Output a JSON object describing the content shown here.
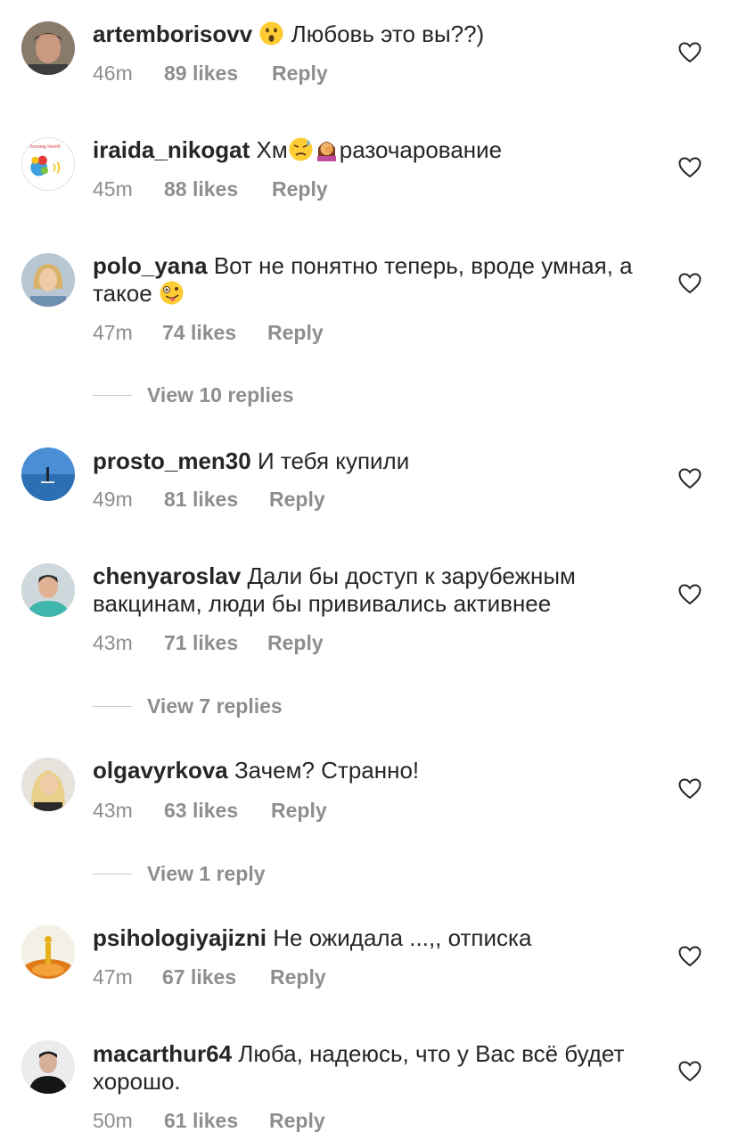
{
  "comments": [
    {
      "username": "artemborisovv",
      "pre": " ",
      "emoji": "surprised-face",
      "post": " Любовь это вы??)",
      "time": "46m",
      "likes": "89 likes",
      "reply": "Reply"
    },
    {
      "username": "iraida_nikogat",
      "text": " Хм",
      "emoji1": "sad-sweat-face",
      "emoji2": "facepalm-woman",
      "post": "разочарование",
      "time": "45m",
      "likes": "88 likes",
      "reply": "Reply",
      "avatar_text": "Логопед Челяб"
    },
    {
      "username": "polo_yana",
      "text": " Вот не понятно теперь, вроде умная, а такое ",
      "emoji": "zany-face",
      "time": "47m",
      "likes": "74 likes",
      "reply": "Reply"
    },
    {
      "username": "prosto_men30",
      "text": " И тебя купили",
      "time": "49m",
      "likes": "81 likes",
      "reply": "Reply"
    },
    {
      "username": "chenyaroslav",
      "text": " Дали бы доступ к зарубежным вакцинам, люди бы прививались активнее",
      "time": "43m",
      "likes": "71 likes",
      "reply": "Reply"
    },
    {
      "username": "olgavyrkova",
      "text": " Зачем? Странно!",
      "time": "43m",
      "likes": "63 likes",
      "reply": "Reply"
    },
    {
      "username": "psihologiyajizni",
      "text": " Не ожидала ...,, отписка",
      "time": "47m",
      "likes": "67 likes",
      "reply": "Reply"
    },
    {
      "username": "macarthur64",
      "text": " Люба, надеюсь, что у Вас всё будет хорошо.",
      "time": "50m",
      "likes": "61 likes",
      "reply": "Reply"
    }
  ],
  "view_replies": [
    "View 10 replies",
    "View 7 replies",
    "View 1 reply"
  ],
  "icons": {
    "like": "heart-outline-icon"
  },
  "colors": {
    "text": "#262626",
    "secondary": "#8e8e8e",
    "divider": "#c7c7c7"
  }
}
